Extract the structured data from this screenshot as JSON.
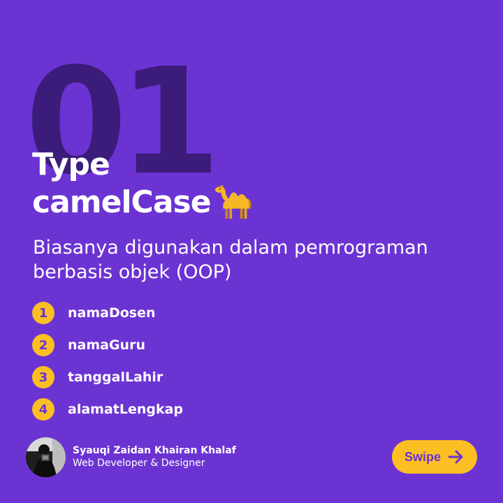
{
  "background_color": "#6c33d3",
  "accent_color": "#fbbf24",
  "watermark_number": "01",
  "title": {
    "line1": "Type",
    "line2": "camelCase",
    "icon": "camel-icon"
  },
  "subtitle": "Biasanya digunakan dalam pemrograman berbasis objek (OOP)",
  "examples": [
    {
      "number": "1",
      "label": "namaDosen"
    },
    {
      "number": "2",
      "label": "namaGuru"
    },
    {
      "number": "3",
      "label": "tanggalLahir"
    },
    {
      "number": "4",
      "label": "alamatLengkap"
    }
  ],
  "author": {
    "name": "Syauqi Zaidan Khairan Khalaf",
    "role": "Web Developer & Designer"
  },
  "swipe_button": {
    "label": "Swipe",
    "icon": "arrow-right-icon"
  }
}
